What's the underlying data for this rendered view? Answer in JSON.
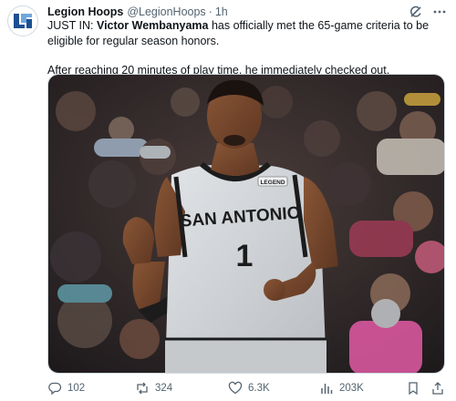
{
  "author": {
    "name": "Legion Hoops",
    "handle": "@LegionHoops",
    "separator": "·",
    "time": "1h",
    "avatar_icon": "legion-hoops-logo-icon"
  },
  "header_actions": {
    "grok_icon": "grok-icon",
    "more_icon": "more-dots-icon"
  },
  "tweet": {
    "prefix": "JUST IN: ",
    "player_name": "Victor Wembanyama",
    "line1_rest": " has officially met the 65-game criteria to be eligible for regular season honors.",
    "line2": "After reaching 20 minutes of play time, he immediately checked out."
  },
  "media": {
    "jersey_text": "SAN ANTONIO",
    "jersey_number": "1",
    "patch_text": "LEGEND",
    "colors": {
      "jersey": "#d4d7da",
      "trim": "#1c1c1c",
      "skin": "#7a4a2e"
    }
  },
  "actions": {
    "replies": "102",
    "reposts": "324",
    "likes": "6.3K",
    "views": "203K"
  },
  "colors": {
    "text": "#0f1419",
    "secondary": "#536471",
    "border": "#cfd9de"
  }
}
